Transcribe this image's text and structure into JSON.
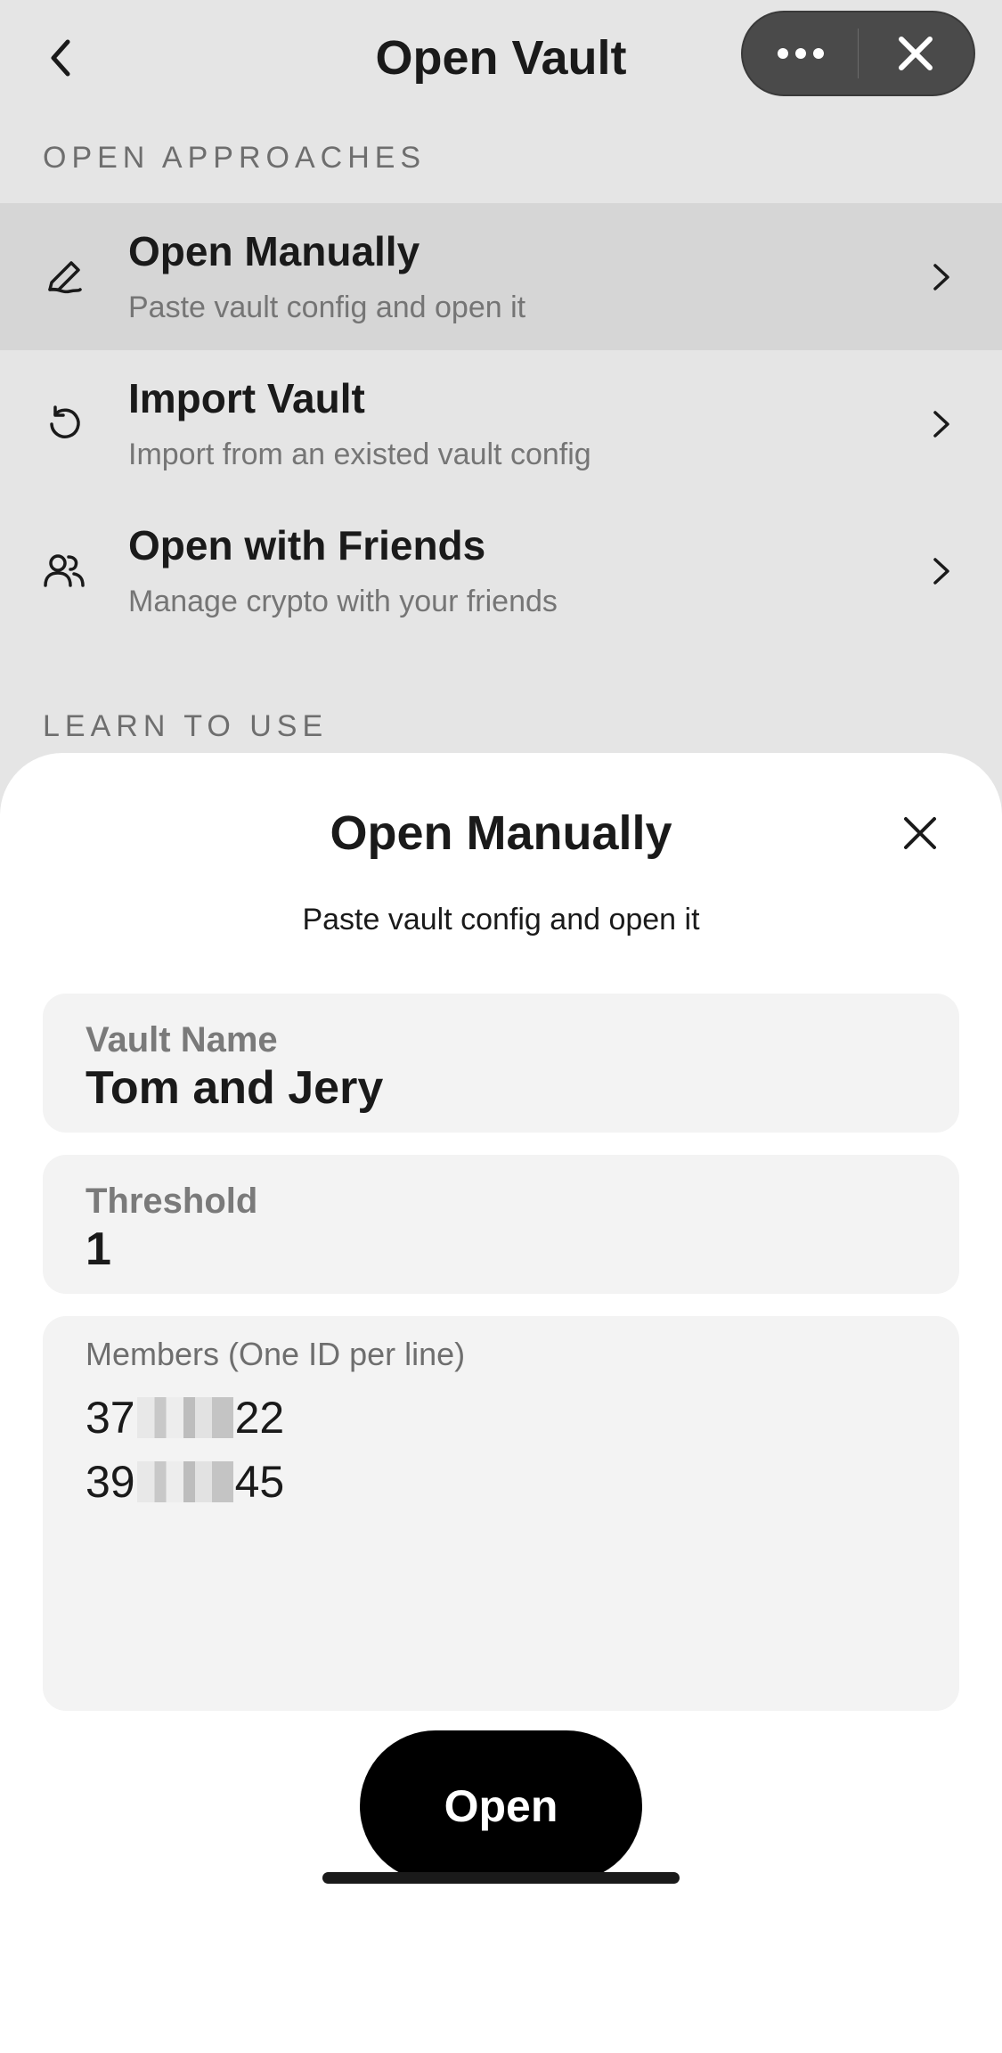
{
  "nav": {
    "title": "Open Vault",
    "back_icon": "chevron-left-icon",
    "more_icon": "more-dots-icon",
    "close_icon": "close-icon"
  },
  "sections": {
    "approaches_label": "OPEN APPROACHES",
    "learn_label": "LEARN TO USE"
  },
  "menu_items": [
    {
      "icon": "pen-icon",
      "title": "Open Manually",
      "subtitle": "Paste vault config and open it",
      "active": true
    },
    {
      "icon": "history-icon",
      "title": "Import Vault",
      "subtitle": "Import from an existed vault config",
      "active": false
    },
    {
      "icon": "users-icon",
      "title": "Open with Friends",
      "subtitle": "Manage crypto with your friends",
      "active": false
    }
  ],
  "sheet": {
    "title": "Open Manually",
    "subtitle": "Paste vault config and open it",
    "vault_name": {
      "label": "Vault Name",
      "value": "Tom and Jery"
    },
    "threshold": {
      "label": "Threshold",
      "value": "1"
    },
    "members": {
      "label": "Members (One ID per line)",
      "lines": [
        {
          "prefix": "37",
          "suffix": "22"
        },
        {
          "prefix": "39",
          "suffix": "45"
        }
      ]
    },
    "open_button": "Open"
  },
  "colors": {
    "page_bg": "#e5e5e5",
    "active_row": "#d6d6d6",
    "field_bg": "#f3f3f3",
    "primary_button": "#000000"
  }
}
